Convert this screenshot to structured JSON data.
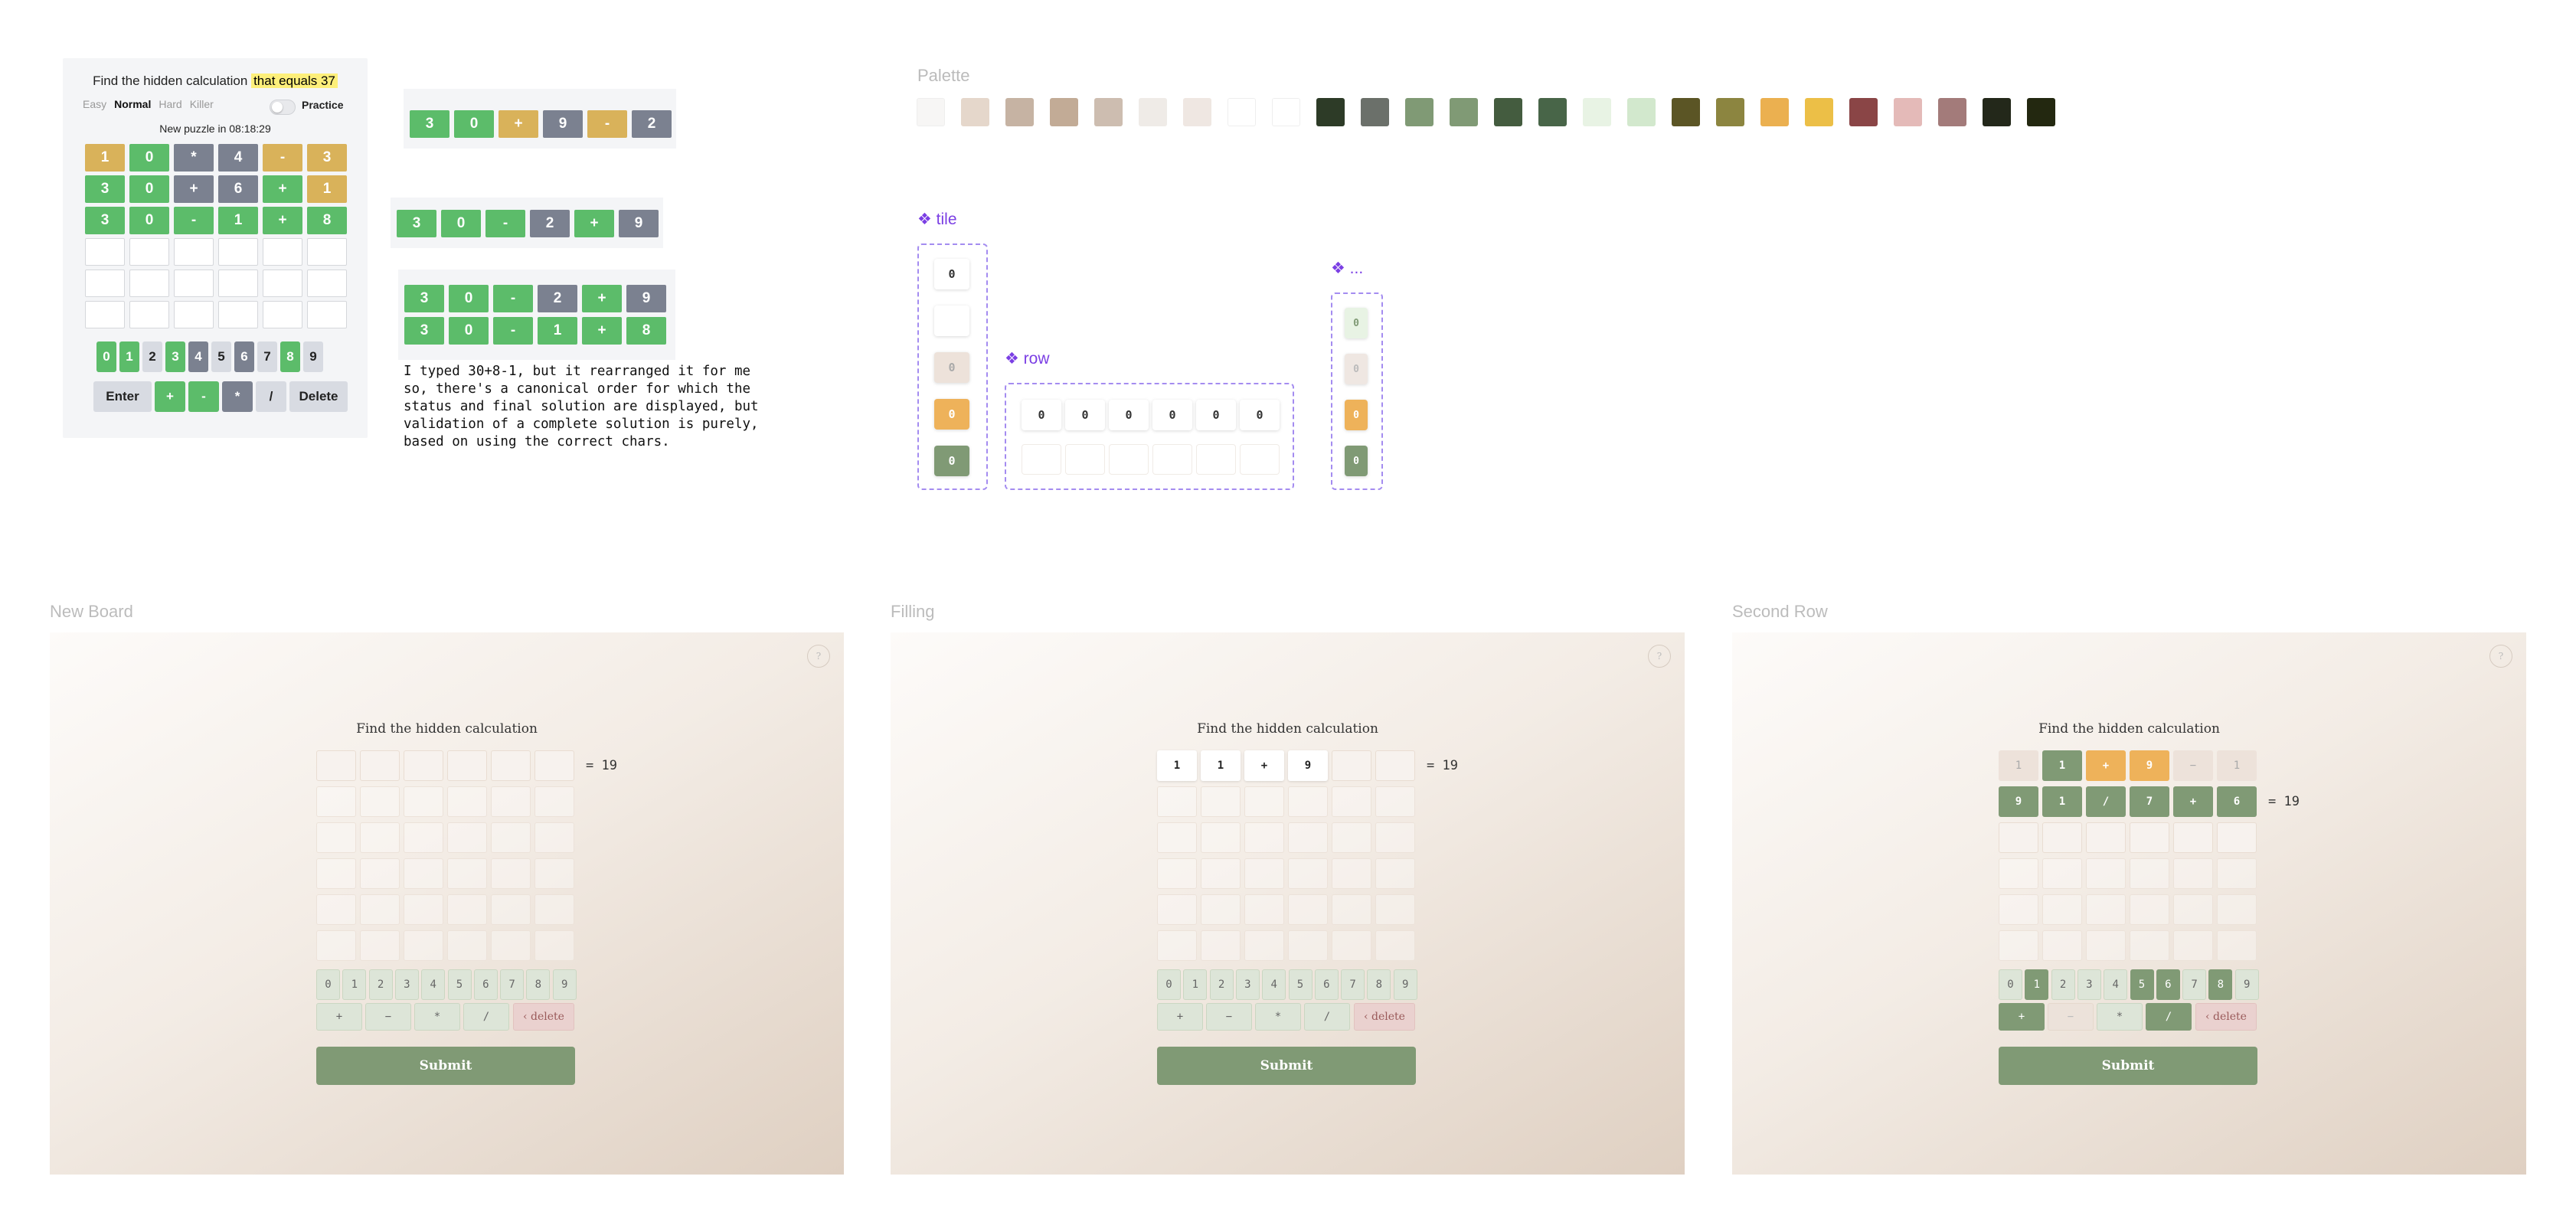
{
  "reference": {
    "title": "Find the hidden calculation",
    "title_highlight": "that equals 37",
    "modes": [
      "Easy",
      "Normal",
      "Hard",
      "Killer"
    ],
    "selected_mode": "Normal",
    "practice_label": "Practice",
    "new_puzzle": "New puzzle in 08:18:29",
    "rows": [
      [
        [
          "1",
          "y"
        ],
        [
          "0",
          "g"
        ],
        [
          "*",
          "s"
        ],
        [
          "4",
          "s"
        ],
        [
          "-",
          "y"
        ],
        [
          "3",
          "y"
        ]
      ],
      [
        [
          "3",
          "g"
        ],
        [
          "0",
          "g"
        ],
        [
          "+",
          "s"
        ],
        [
          "6",
          "s"
        ],
        [
          "+",
          "g"
        ],
        [
          "1",
          "y"
        ]
      ],
      [
        [
          "3",
          "g"
        ],
        [
          "0",
          "g"
        ],
        [
          "-",
          "g"
        ],
        [
          "1",
          "g"
        ],
        [
          "+",
          "g"
        ],
        [
          "8",
          "g"
        ]
      ]
    ],
    "digit_keys": [
      [
        "0",
        "g"
      ],
      [
        "1",
        "g"
      ],
      [
        "2",
        ""
      ],
      [
        "3",
        "g"
      ],
      [
        "4",
        "s"
      ],
      [
        "5",
        ""
      ],
      [
        "6",
        "s"
      ],
      [
        "7",
        ""
      ],
      [
        "8",
        "g"
      ],
      [
        "9",
        ""
      ]
    ],
    "op_keys": [
      [
        "Enter",
        ""
      ],
      [
        "+",
        "g"
      ],
      [
        "-",
        "g"
      ],
      [
        "*",
        "s"
      ],
      [
        "/",
        ""
      ],
      [
        "Delete",
        ""
      ]
    ]
  },
  "snippets": {
    "snip1_row": [
      [
        "3",
        "g"
      ],
      [
        "0",
        "g"
      ],
      [
        "+",
        "y"
      ],
      [
        "9",
        "s"
      ],
      [
        "-",
        "y"
      ],
      [
        "2",
        "s"
      ]
    ],
    "snip2_row": [
      [
        "3",
        "g"
      ],
      [
        "0",
        "g"
      ],
      [
        "-",
        "g"
      ],
      [
        "2",
        "s"
      ],
      [
        "+",
        "g"
      ],
      [
        "9",
        "s"
      ]
    ],
    "snip3_rows": [
      [
        [
          "3",
          "g"
        ],
        [
          "0",
          "g"
        ],
        [
          "-",
          "g"
        ],
        [
          "2",
          "s"
        ],
        [
          "+",
          "g"
        ],
        [
          "9",
          "s"
        ]
      ],
      [
        [
          "3",
          "g"
        ],
        [
          "0",
          "g"
        ],
        [
          "-",
          "g"
        ],
        [
          "1",
          "g"
        ],
        [
          "+",
          "g"
        ],
        [
          "8",
          "g"
        ]
      ]
    ],
    "note": "I typed 30+8-1, but it rearranged it for me\nso, there's a canonical order for which the\nstatus and final solution are displayed, but\nvalidation of a complete solution is purely,\nbased on using the correct chars."
  },
  "palette": {
    "label": "Palette",
    "colors": [
      "#f7f6f5",
      "#e5d7cb",
      "#c6b3a3",
      "#c2ab96",
      "#cdbdb0",
      "#efebe7",
      "#efe7e2",
      "#ffffff",
      "#ffffff",
      "#2d3b27",
      "#6b706a",
      "#809a75",
      "#809a75",
      "#445c3f",
      "#486548",
      "#e8f3e4",
      "#d2e8cd",
      "#5b5525",
      "#8c8540",
      "#ebb050",
      "#ecbf47",
      "#8a4546",
      "#e4bab8",
      "#a37b7a",
      "#23281a",
      "#232810"
    ]
  },
  "components": {
    "tile_label": "tile",
    "row_label": "row",
    "more_label": "...",
    "tile_value": "0"
  },
  "frames": [
    {
      "label": "New Board"
    },
    {
      "label": "Filling"
    },
    {
      "label": "Second Row"
    }
  ],
  "board": {
    "title": "Find the hidden calculation",
    "target": "= 19",
    "help": "?",
    "submit": "Submit",
    "digits": [
      "0",
      "1",
      "2",
      "3",
      "4",
      "5",
      "6",
      "7",
      "8",
      "9"
    ],
    "ops": [
      "+",
      "−",
      "*",
      "/"
    ],
    "delete": "‹ delete",
    "filling_row": [
      "1",
      "1",
      "+",
      "9",
      "",
      ""
    ],
    "second_rows": [
      [
        [
          "1",
          "x"
        ],
        [
          "1",
          "g"
        ],
        [
          "+",
          "o"
        ],
        [
          "9",
          "o"
        ],
        [
          "−",
          "x"
        ],
        [
          "1",
          "x"
        ]
      ],
      [
        [
          "9",
          "g"
        ],
        [
          "1",
          "g"
        ],
        [
          "/",
          "g"
        ],
        [
          "7",
          "g"
        ],
        [
          "+",
          "g"
        ],
        [
          "6",
          "g"
        ]
      ]
    ],
    "second_digit_states": [
      "",
      "g",
      "",
      "",
      "",
      "g",
      "g",
      "",
      "g",
      ""
    ],
    "second_op_states": [
      "g",
      "x",
      "",
      "g"
    ]
  }
}
